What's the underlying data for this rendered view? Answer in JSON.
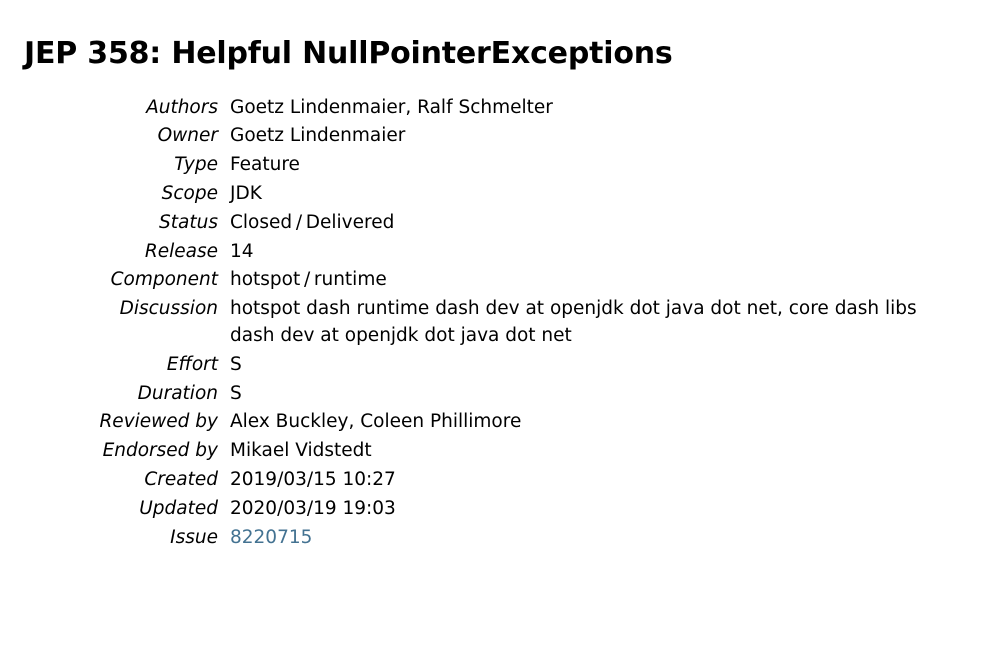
{
  "title": "JEP 358: Helpful NullPointerExceptions",
  "rows": [
    {
      "label": "Authors",
      "value": "Goetz Lindenmaier, Ralf Schmelter"
    },
    {
      "label": "Owner",
      "value": "Goetz Lindenmaier"
    },
    {
      "label": "Type",
      "value": "Feature"
    },
    {
      "label": "Scope",
      "value": "JDK"
    },
    {
      "label": "Status",
      "value": "Closed / Delivered"
    },
    {
      "label": "Release",
      "value": "14"
    },
    {
      "label": "Component",
      "value": "hotspot / runtime"
    },
    {
      "label": "Discussion",
      "value": "hotspot dash runtime dash dev at openjdk dot java dot net, core dash libs dash dev at openjdk dot java dot net"
    },
    {
      "label": "Effort",
      "value": "S"
    },
    {
      "label": "Duration",
      "value": "S"
    },
    {
      "label": "Reviewed by",
      "value": "Alex Buckley, Coleen Phillimore"
    },
    {
      "label": "Endorsed by",
      "value": "Mikael Vidstedt"
    },
    {
      "label": "Created",
      "value": "2019/03/15 10:27"
    },
    {
      "label": "Updated",
      "value": "2020/03/19 19:03"
    },
    {
      "label": "Issue",
      "value": "8220715",
      "link": true
    }
  ]
}
